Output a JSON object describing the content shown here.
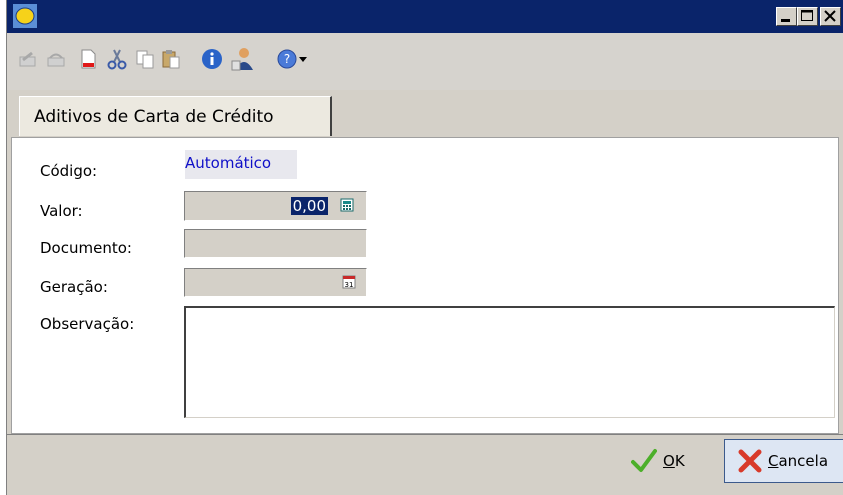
{
  "window": {
    "title": "",
    "controls": [
      "minimize",
      "maximize",
      "close"
    ]
  },
  "toolbar": {
    "buttons": [
      {
        "name": "edit-icon",
        "enabled": false
      },
      {
        "name": "undo-icon",
        "enabled": false
      },
      {
        "name": "new-document-icon",
        "enabled": true
      },
      {
        "name": "cut-icon",
        "enabled": true
      },
      {
        "name": "copy-icon",
        "enabled": true
      },
      {
        "name": "paste-icon",
        "enabled": true
      },
      {
        "name": "info-icon",
        "enabled": true
      },
      {
        "name": "user-icon",
        "enabled": true
      },
      {
        "name": "help-icon",
        "enabled": true
      }
    ]
  },
  "tab": {
    "label": "Aditivos de Carta de Crédito"
  },
  "form": {
    "codigo_label": "Código:",
    "codigo_value": "Automático",
    "valor_label": "Valor:",
    "valor_value": "0,00",
    "documento_label": "Documento:",
    "documento_value": "",
    "geracao_label": "Geração:",
    "geracao_value": "",
    "observacao_label": "Observação:",
    "observacao_value": ""
  },
  "footer": {
    "ok_label": "OK",
    "ok_mnemonic": "O",
    "ok_rest": "K",
    "cancel_label": "Cancela",
    "cancel_mnemonic": "C",
    "cancel_rest": "ancela"
  },
  "colors": {
    "title_bar": "#0a246a",
    "auto_text": "#1010c8",
    "selection": "#0a246a",
    "ok_check": "#4caf2a",
    "cancel_x": "#d83a2a"
  }
}
